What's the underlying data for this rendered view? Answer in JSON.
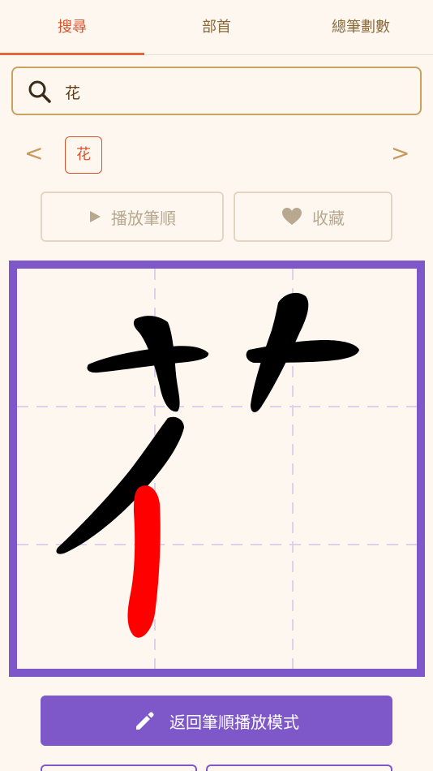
{
  "tabs": [
    {
      "label": "搜尋",
      "active": true
    },
    {
      "label": "部首",
      "active": false
    },
    {
      "label": "總筆劃數",
      "active": false
    }
  ],
  "search": {
    "value": "花",
    "icon": "search-icon"
  },
  "nav": {
    "prev": "<",
    "next": ">",
    "current_char": "花"
  },
  "actions": {
    "play_label": "播放筆順",
    "favorite_label": "收藏"
  },
  "stroke_canvas": {
    "character": "花",
    "stroke_count_shown": 5,
    "highlight_stroke": 5,
    "highlight_color": "#ff0000",
    "stroke_color": "#000000",
    "border_color": "#7e57c8"
  },
  "main_button": {
    "label": "返回筆順播放模式",
    "icon": "pencil-icon"
  },
  "colors": {
    "accent": "#d6552f",
    "purple": "#7e57c8",
    "background": "#fdf7f0"
  }
}
